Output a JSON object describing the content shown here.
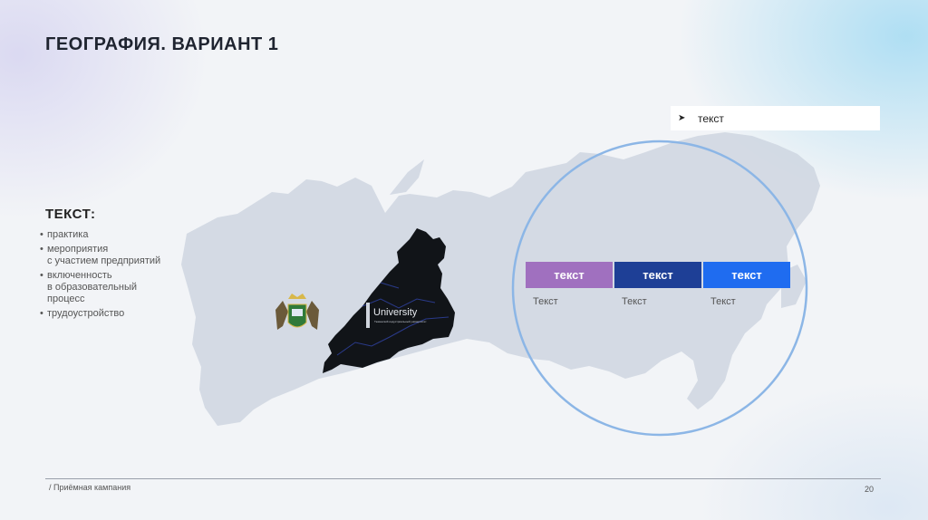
{
  "slide": {
    "title": "ГЕОГРАФИЯ. ВАРИАНТ 1",
    "text_block": {
      "heading": "ТЕКСТ:",
      "bullets": [
        "практика",
        "мероприятия\nс участием предприятий",
        "включенность\nв образовательный\nпроцесс",
        "трудоустройство"
      ]
    },
    "map": {
      "logo_text": "University",
      "logo_subtext": "Тюменский индустриальный университет"
    },
    "callout": {
      "arrow_icon": "arrow-right-icon",
      "label": "текст"
    },
    "bars": [
      {
        "label": "текст",
        "caption": "Текст",
        "color": "#a070bf"
      },
      {
        "label": "текст",
        "caption": "Текст",
        "color": "#1e3f96"
      },
      {
        "label": "текст",
        "caption": "Текст",
        "color": "#1f6cf0"
      }
    ],
    "footer": {
      "text": "/ Приёмная кампания",
      "page_number": "20"
    }
  }
}
